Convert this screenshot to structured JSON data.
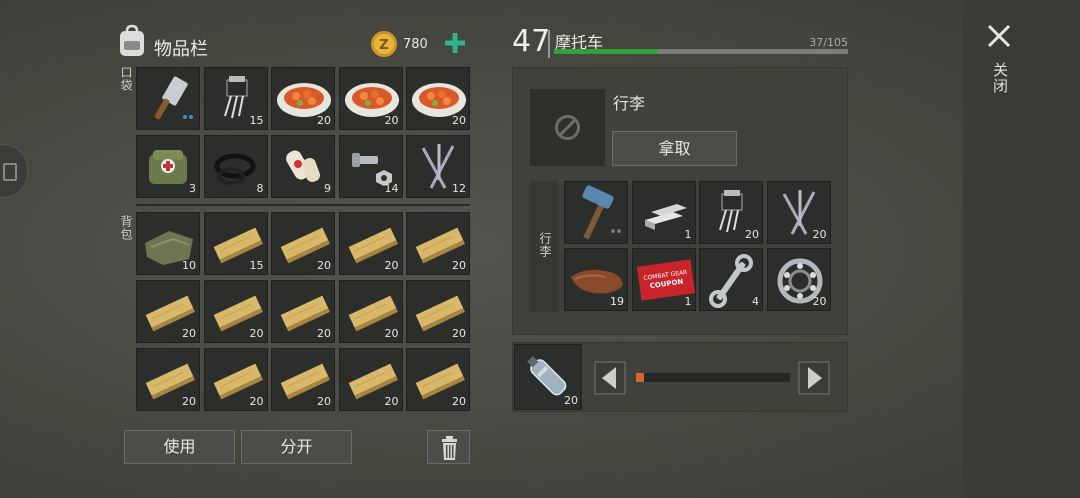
{
  "inventory": {
    "title": "物品栏",
    "coins": "780",
    "pocket_label": "口袋",
    "backpack_label": "背包",
    "use_label": "使用",
    "split_label": "分开",
    "pocket_items": [
      {
        "name": "cleaver",
        "count": ""
      },
      {
        "name": "transistor",
        "count": "15"
      },
      {
        "name": "food-plate",
        "count": "20"
      },
      {
        "name": "food-plate",
        "count": "20"
      },
      {
        "name": "food-plate",
        "count": "20"
      },
      {
        "name": "medkit-bag",
        "count": "3"
      },
      {
        "name": "rubber-seals",
        "count": "8"
      },
      {
        "name": "bandage",
        "count": "9"
      },
      {
        "name": "bolt-nut",
        "count": "14"
      },
      {
        "name": "nails",
        "count": "12"
      }
    ],
    "backpack_items": [
      {
        "name": "cloth",
        "count": "10"
      },
      {
        "name": "wood-plank",
        "count": "15"
      },
      {
        "name": "wood-plank",
        "count": "20"
      },
      {
        "name": "wood-plank",
        "count": "20"
      },
      {
        "name": "wood-plank",
        "count": "20"
      },
      {
        "name": "wood-plank",
        "count": "20"
      },
      {
        "name": "wood-plank",
        "count": "20"
      },
      {
        "name": "wood-plank",
        "count": "20"
      },
      {
        "name": "wood-plank",
        "count": "20"
      },
      {
        "name": "wood-plank",
        "count": "20"
      },
      {
        "name": "wood-plank",
        "count": "20"
      },
      {
        "name": "wood-plank",
        "count": "20"
      },
      {
        "name": "wood-plank",
        "count": "20"
      },
      {
        "name": "wood-plank",
        "count": "20"
      },
      {
        "name": "wood-plank",
        "count": "20"
      }
    ]
  },
  "vehicle": {
    "level": "47",
    "name": "摩托车",
    "progress_text": "37/105",
    "progress_fraction": 0.352,
    "luggage_title": "行李",
    "take_label": "拿取",
    "luggage_label": "行李",
    "luggage_items": [
      {
        "name": "hammer",
        "count": ""
      },
      {
        "name": "metal-bars",
        "count": "1"
      },
      {
        "name": "transistor",
        "count": "20"
      },
      {
        "name": "nails",
        "count": "20"
      },
      {
        "name": "leather",
        "count": "19"
      },
      {
        "name": "combat-gear-coupon",
        "count": "1"
      },
      {
        "name": "wrench",
        "count": "4"
      },
      {
        "name": "bearing",
        "count": "20"
      }
    ],
    "fuel": {
      "item": "water-bottle",
      "count": "20",
      "slider_fraction": 0.05
    }
  },
  "close_label": "关闭",
  "coupon_text_1": "COMBAT GEAR",
  "coupon_text_2": "COUPON"
}
